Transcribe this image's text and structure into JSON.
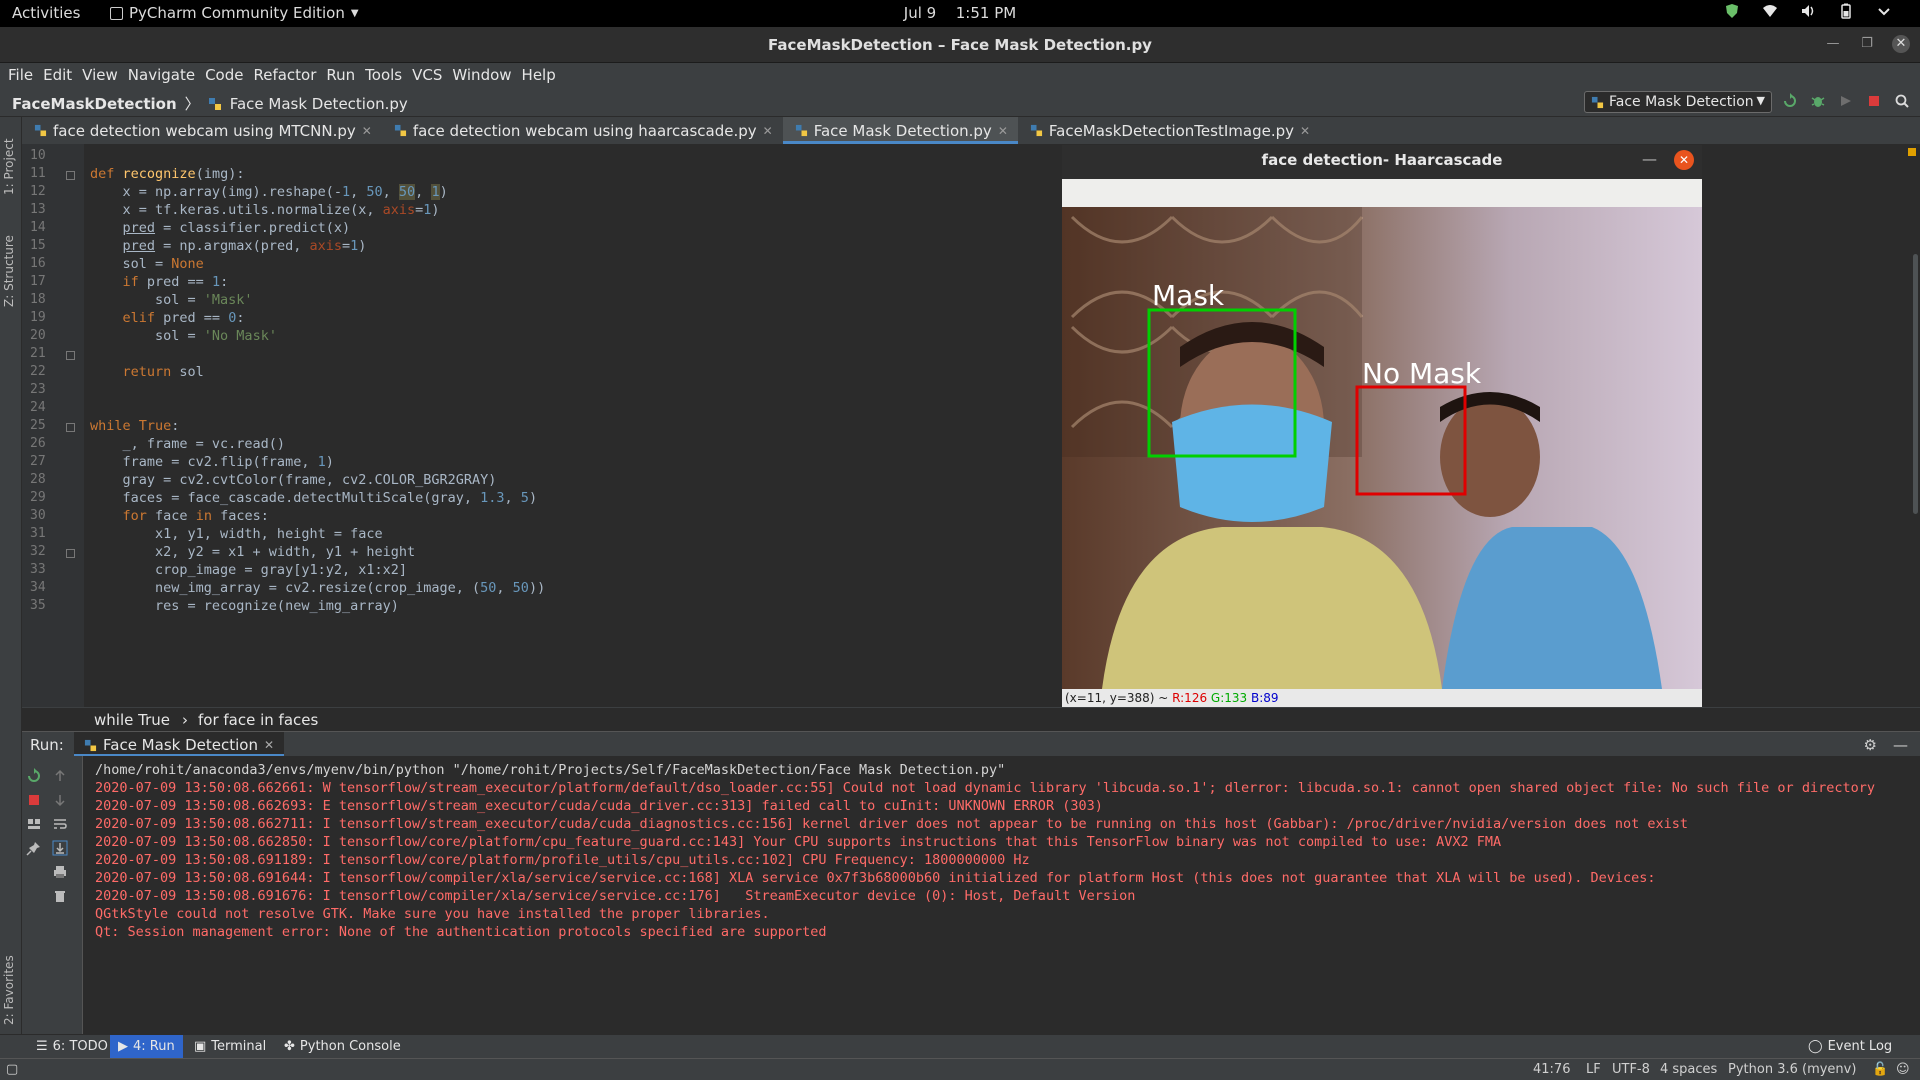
{
  "topbar": {
    "activities": "Activities",
    "app_menu": "PyCharm Community Edition",
    "date": "Jul 9",
    "time": "1:51 PM"
  },
  "window": {
    "title": "FaceMaskDetection – Face Mask Detection.py"
  },
  "menu": [
    "File",
    "Edit",
    "View",
    "Navigate",
    "Code",
    "Refactor",
    "Run",
    "Tools",
    "VCS",
    "Window",
    "Help"
  ],
  "navbar": {
    "project": "FaceMaskDetection",
    "file": "Face Mask Detection.py",
    "run_config": "Face Mask Detection"
  },
  "left_tabs": {
    "project": "1: Project",
    "structure": "Z: Structure",
    "favorites": "2: Favorites"
  },
  "tabs": [
    {
      "label": "face detection webcam using MTCNN.py",
      "active": false
    },
    {
      "label": "face detection webcam using haarcascade.py",
      "active": false
    },
    {
      "label": "Face Mask Detection.py",
      "active": true
    },
    {
      "label": "FaceMaskDetectionTestImage.py",
      "active": false
    }
  ],
  "editor": {
    "line_numbers": [
      "10",
      "11",
      "12",
      "13",
      "14",
      "15",
      "16",
      "17",
      "18",
      "19",
      "20",
      "21",
      "22",
      "23",
      "24",
      "25",
      "26",
      "27",
      "28",
      "29",
      "30",
      "31",
      "32",
      "33",
      "34",
      "35"
    ]
  },
  "breadcrumb": {
    "items": [
      "while True",
      "for face in faces"
    ]
  },
  "cv_window": {
    "title": "face detection- Haarcascade",
    "label_mask": "Mask",
    "label_no_mask": "No Mask",
    "status_coords": "(x=11, y=388) ~ ",
    "status_r": "R:126",
    "status_g": "G:133",
    "status_b": "B:89"
  },
  "run_panel": {
    "label": "Run:",
    "tab": "Face Mask Detection",
    "lines": [
      "/home/rohit/anaconda3/envs/myenv/bin/python \"/home/rohit/Projects/Self/FaceMaskDetection/Face Mask Detection.py\"",
      "2020-07-09 13:50:08.662661: W tensorflow/stream_executor/platform/default/dso_loader.cc:55] Could not load dynamic library 'libcuda.so.1'; dlerror: libcuda.so.1: cannot open shared object file: No such file or directory",
      "2020-07-09 13:50:08.662693: E tensorflow/stream_executor/cuda/cuda_driver.cc:313] failed call to cuInit: UNKNOWN ERROR (303)",
      "2020-07-09 13:50:08.662711: I tensorflow/stream_executor/cuda/cuda_diagnostics.cc:156] kernel driver does not appear to be running on this host (Gabbar): /proc/driver/nvidia/version does not exist",
      "2020-07-09 13:50:08.662850: I tensorflow/core/platform/cpu_feature_guard.cc:143] Your CPU supports instructions that this TensorFlow binary was not compiled to use: AVX2 FMA",
      "2020-07-09 13:50:08.691189: I tensorflow/core/platform/profile_utils/cpu_utils.cc:102] CPU Frequency: 1800000000 Hz",
      "2020-07-09 13:50:08.691644: I tensorflow/compiler/xla/service/service.cc:168] XLA service 0x7f3b68000b60 initialized for platform Host (this does not guarantee that XLA will be used). Devices:",
      "2020-07-09 13:50:08.691676: I tensorflow/compiler/xla/service/service.cc:176]   StreamExecutor device (0): Host, Default Version",
      "QGtkStyle could not resolve GTK. Make sure you have installed the proper libraries.",
      "Qt: Session management error: None of the authentication protocols specified are supported"
    ]
  },
  "tool_windows": {
    "todo": "6: TODO",
    "run": "4: Run",
    "terminal": "Terminal",
    "python_console": "Python Console",
    "event_log": "Event Log"
  },
  "status": {
    "position": "41:76",
    "line_sep": "LF",
    "encoding": "UTF-8",
    "indent": "4 spaces",
    "interpreter": "Python 3.6 (myenv)"
  },
  "colors": {
    "accent": "#4a88c7",
    "run_active": "#2f65ca",
    "console_error": "#ff6b68",
    "mask_box": "#00d000",
    "no_mask_box": "#e00000"
  }
}
